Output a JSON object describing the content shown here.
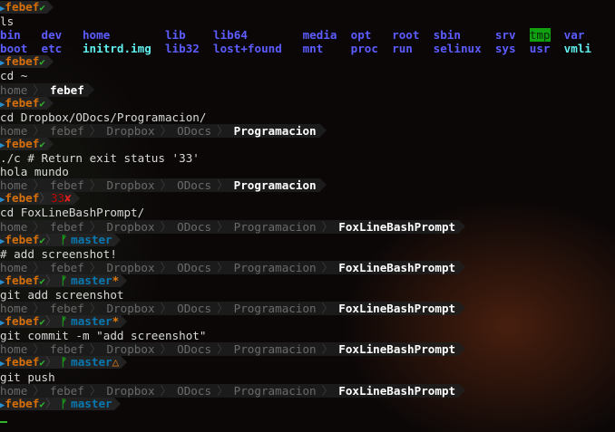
{
  "user": "febef",
  "colors": {
    "user": "#d7700a",
    "ok": "#2fb32f",
    "branch": "#0a78b0",
    "dirty": "#e07a10",
    "dir": "#5c5cff",
    "prompt_arrow": "#2a8fd0"
  },
  "icons": {
    "ok": "✔",
    "err": "✘",
    "branch": "ᚠ",
    "dirty": "*",
    "ahead": "△"
  },
  "lines": [
    {
      "t": "prompt"
    },
    {
      "t": "cmd",
      "text": "ls"
    },
    {
      "t": "ls",
      "items": [
        {
          "n": "bin"
        },
        {
          "n": "dev"
        },
        {
          "n": "home"
        },
        {
          "n": "lib"
        },
        {
          "n": "lib64"
        },
        {
          "n": "media"
        },
        {
          "n": "opt"
        },
        {
          "n": "root"
        },
        {
          "n": "sbin"
        },
        {
          "n": "srv"
        },
        {
          "n": "tmp",
          "k": "hl"
        },
        {
          "n": "var"
        }
      ]
    },
    {
      "t": "ls",
      "items": [
        {
          "n": "boot"
        },
        {
          "n": "etc"
        },
        {
          "n": "initrd.img",
          "k": "file"
        },
        {
          "n": "lib32"
        },
        {
          "n": "lost+found"
        },
        {
          "n": "mnt"
        },
        {
          "n": "proc"
        },
        {
          "n": "run"
        },
        {
          "n": "selinux"
        },
        {
          "n": "sys"
        },
        {
          "n": "usr"
        },
        {
          "n": "vmli",
          "k": "file"
        }
      ]
    },
    {
      "t": "prompt"
    },
    {
      "t": "cmd",
      "text": "cd ~"
    },
    {
      "t": "path",
      "segs": [
        "home",
        "febef"
      ]
    },
    {
      "t": "prompt"
    },
    {
      "t": "cmd",
      "text": "cd Dropbox/ODocs/Programacion/"
    },
    {
      "t": "path",
      "segs": [
        "home",
        "febef",
        "Dropbox",
        "ODocs",
        "Programacion"
      ]
    },
    {
      "t": "prompt"
    },
    {
      "t": "cmd",
      "text": "./c # Return exit status '33'"
    },
    {
      "t": "cmd",
      "text": "hola mundo"
    },
    {
      "t": "path",
      "segs": [
        "home",
        "febef",
        "Dropbox",
        "ODocs",
        "Programacion"
      ]
    },
    {
      "t": "prompt",
      "status": "33"
    },
    {
      "t": "cmd",
      "text": "cd FoxLineBashPrompt/"
    },
    {
      "t": "path",
      "segs": [
        "home",
        "febef",
        "Dropbox",
        "ODocs",
        "Programacion",
        "FoxLineBashPrompt"
      ]
    },
    {
      "t": "prompt",
      "branch": "master"
    },
    {
      "t": "cmd",
      "text": "# add screenshot!"
    },
    {
      "t": "path",
      "segs": [
        "home",
        "febef",
        "Dropbox",
        "ODocs",
        "Programacion",
        "FoxLineBashPrompt"
      ]
    },
    {
      "t": "prompt",
      "branch": "master",
      "mark": "*"
    },
    {
      "t": "cmd",
      "text": "git add screenshot"
    },
    {
      "t": "path",
      "segs": [
        "home",
        "febef",
        "Dropbox",
        "ODocs",
        "Programacion",
        "FoxLineBashPrompt"
      ]
    },
    {
      "t": "prompt",
      "branch": "master",
      "mark": "*"
    },
    {
      "t": "cmd",
      "text": "git commit -m \"add screenshot\""
    },
    {
      "t": "path",
      "segs": [
        "home",
        "febef",
        "Dropbox",
        "ODocs",
        "Programacion",
        "FoxLineBashPrompt"
      ]
    },
    {
      "t": "prompt",
      "branch": "master",
      "mark": "△"
    },
    {
      "t": "cmd",
      "text": "git push"
    },
    {
      "t": "path",
      "segs": [
        "home",
        "febef",
        "Dropbox",
        "ODocs",
        "Programacion",
        "FoxLineBashPrompt"
      ]
    },
    {
      "t": "prompt",
      "branch": "master"
    },
    {
      "t": "cursor"
    }
  ]
}
